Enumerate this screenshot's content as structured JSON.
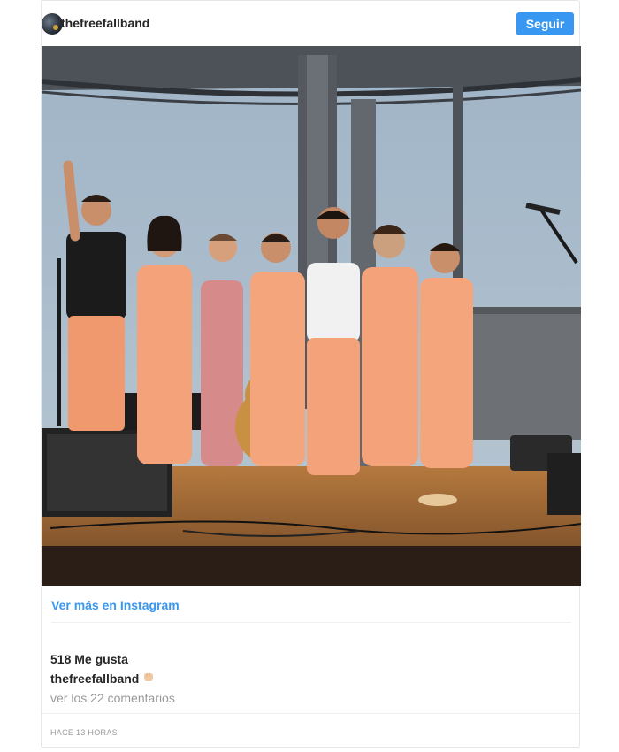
{
  "post": {
    "username": "thefreefallband",
    "follow_label": "Seguir",
    "view_more_label": "Ver más en Instagram",
    "likes_text": "518 Me gusta",
    "caption_user": "thefreefallband",
    "caption_emoji": "fist-emoji",
    "comments_link": "ver los 22 comentarios",
    "timestamp": "HACE 13 HORAS"
  },
  "colors": {
    "accent": "#3897f0",
    "text": "#262626",
    "muted": "#999999",
    "jumpsuit": "#f3a27a"
  }
}
